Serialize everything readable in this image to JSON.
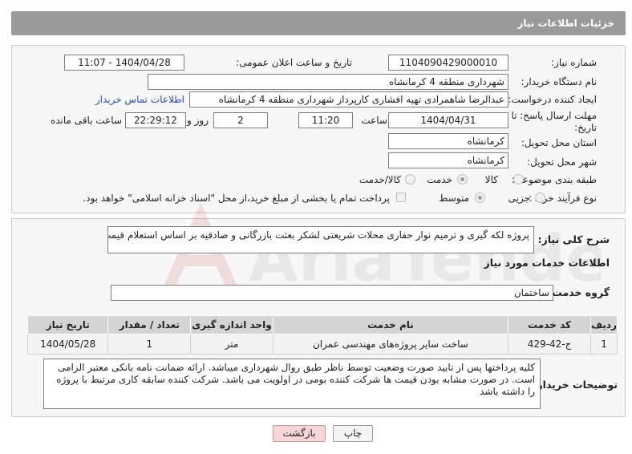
{
  "header": {
    "title": "جزئیات اطلاعات نیاز"
  },
  "need": {
    "number_label": "شماره نیاز:",
    "number_value": "1104090429000010",
    "announce_label": "تاریخ و ساعت اعلان عمومی:",
    "announce_value": "1404/04/28 - 11:07",
    "buyer_label": "نام دستگاه خریدار:",
    "buyer_value": "شهرداری منطقه 4 کرمانشاه",
    "creator_label": "ایجاد کننده درخواست:",
    "creator_value": "عبدالرضا شاهمرادی تهیه افشاری کارپرداز شهرداری منطقه 4 کرمانشاه",
    "contact_link": "اطلاعات تماس خریدار",
    "deadline_label_1": "مهلت ارسال پاسخ: تا",
    "deadline_label_2": "تاریخ:",
    "deadline_date": "1404/04/31",
    "time_label": "ساعت",
    "deadline_time": "11:20",
    "days_value": "2",
    "days_label": "روز و",
    "remaining_time": "22:29:12",
    "remaining_label": "ساعت باقی مانده",
    "province_label": "استان محل تحویل:",
    "province_value": "کرمانشاه",
    "city_label": "شهر محل تحویل:",
    "city_value": "کرمانشاه",
    "category_label": "طبقه بندی موضوعی:",
    "category_options": [
      "کالا",
      "خدمت",
      "کالا/خدمت"
    ],
    "category_selected": "خدمت",
    "process_label": "نوع فرآیند خرید :",
    "process_options": [
      "جزیی",
      "متوسط"
    ],
    "process_selected": "متوسط",
    "payment_note": "پرداخت تمام یا بخشی از مبلغ خرید،از محل \"اسناد خزانه اسلامی\" خواهد بود."
  },
  "summary": {
    "label": "شرح کلی نیاز:",
    "value": "پروژه لکه گیری و ترمیم نوار حفاری محلات شریعتی لشکر بعثت بازرگانی و صادقیه بر اساس استعلام قیمت"
  },
  "services": {
    "section_title": "اطلاعات خدمات مورد نیاز",
    "group_label": "گروه خدمت:",
    "group_value": "ساختمان",
    "columns": [
      "ردیف",
      "کد خدمت",
      "نام خدمت",
      "واحد اندازه گیری",
      "تعداد / مقدار",
      "تاریخ نیاز"
    ],
    "rows": [
      [
        "1",
        "ج-42-429",
        "ساخت سایر پروژه‌های مهندسی عمران",
        "متر",
        "1",
        "1404/05/28"
      ]
    ]
  },
  "notes": {
    "label": "توضیحات خریدار:",
    "value": "کلیه پرداختها پس از تایید صورت وضعیت توسط ناظر طبق روال شهرداری میباشد. ارائه ضمانت نامه بانکی معتبر الزامی است. در صورت مشابه بودن قیمت ها شرکت کننده بومی در اولویت می باشد. شرکت کننده سابقه کاری مرتبط با پروژه را داشته باشد"
  },
  "buttons": {
    "print": "چاپ",
    "back": "بازگشت"
  },
  "watermark": {
    "text": "AriaTender.neT"
  }
}
